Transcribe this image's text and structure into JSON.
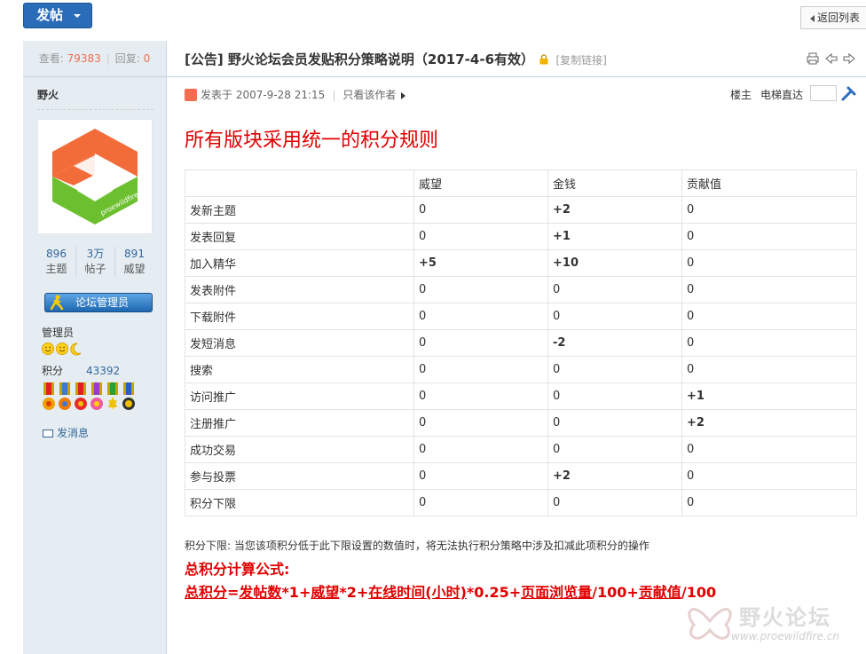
{
  "toolbar": {
    "post_label": "发帖",
    "back_label": "返回列表"
  },
  "thread": {
    "views_label": "查看:",
    "views": "79383",
    "replies_label": "回复:",
    "replies": "0",
    "title": "[公告] 野火论坛会员发贴积分策略说明（2017-4-6有效）",
    "copy_link": "[复制链接]"
  },
  "author": {
    "name": "野火",
    "stats": [
      {
        "value": "896",
        "label": "主题"
      },
      {
        "value": "3万",
        "label": "帖子"
      },
      {
        "value": "891",
        "label": "威望"
      }
    ],
    "group_badge": "论坛管理员",
    "role": "管理员",
    "points_label": "积分",
    "points": "43392",
    "send_pm": "发消息",
    "avatar_text": "proewildfire.cn"
  },
  "post": {
    "posted_at": "发表于 2007-9-28 21:15",
    "only_author": "只看该作者",
    "floor_owner": "楼主",
    "jump_label": "电梯直达",
    "heading": "所有版块采用统一的积分规则"
  },
  "rules_table": {
    "headers": [
      "",
      "威望",
      "金钱",
      "贡献值"
    ],
    "rows": [
      [
        "发新主题",
        "0",
        "+2",
        "0"
      ],
      [
        "发表回复",
        "0",
        "+1",
        "0"
      ],
      [
        "加入精华",
        "+5",
        "+10",
        "0"
      ],
      [
        "发表附件",
        "0",
        "0",
        "0"
      ],
      [
        "下载附件",
        "0",
        "0",
        "0"
      ],
      [
        "发短消息",
        "0",
        "-2",
        "0"
      ],
      [
        "搜索",
        "0",
        "0",
        "0"
      ],
      [
        "访问推广",
        "0",
        "0",
        "+1"
      ],
      [
        "注册推广",
        "0",
        "0",
        "+2"
      ],
      [
        "成功交易",
        "0",
        "0",
        "0"
      ],
      [
        "参与投票",
        "0",
        "+2",
        "0"
      ],
      [
        "积分下限",
        "0",
        "0",
        "0"
      ]
    ]
  },
  "footer_text": {
    "note": "积分下限: 当您该项积分低于此下限设置的数值时，将无法执行积分策略中涉及扣减此项积分的操作",
    "formula_title": "总积分计算公式:",
    "formula_parts": [
      "总积分",
      "=",
      "发帖数",
      "*1+",
      "威望",
      "*2+",
      "在线时间(小时)",
      "*0.25+",
      "页面浏览量",
      "/100+",
      "贡献值",
      "/100"
    ]
  },
  "watermark": {
    "text": "野火论坛",
    "url": "www.proewildfire.cn"
  },
  "colors": {
    "accent_blue": "#2b6cb8",
    "heading_red": "#e00000",
    "sidebar_bg": "#e5edf2",
    "count_orange": "#f26c4f"
  }
}
